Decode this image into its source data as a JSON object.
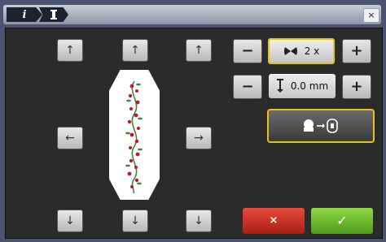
{
  "header": {
    "crumb_info_icon": "i",
    "crumb_tool_icon": "spool-icon",
    "close_label": "×"
  },
  "move": {
    "up": "↑",
    "down": "↓",
    "left": "←",
    "right": "→"
  },
  "repeat": {
    "minus": "−",
    "plus": "+",
    "value": "2 x",
    "icon": "butterfly-icon"
  },
  "spacing": {
    "minus": "−",
    "plus": "+",
    "value": "0.0 mm",
    "icon": "spacing-icon"
  },
  "fit_button": {
    "icon": "hoop-to-fit-icon",
    "arrow": "→"
  },
  "actions": {
    "cancel": "×",
    "confirm": "✓"
  },
  "colors": {
    "accent": "#e6c21a",
    "cancel": "#c7301f",
    "confirm": "#6ab82d",
    "flower": "#c0183c",
    "leaf": "#3f8a2f"
  }
}
